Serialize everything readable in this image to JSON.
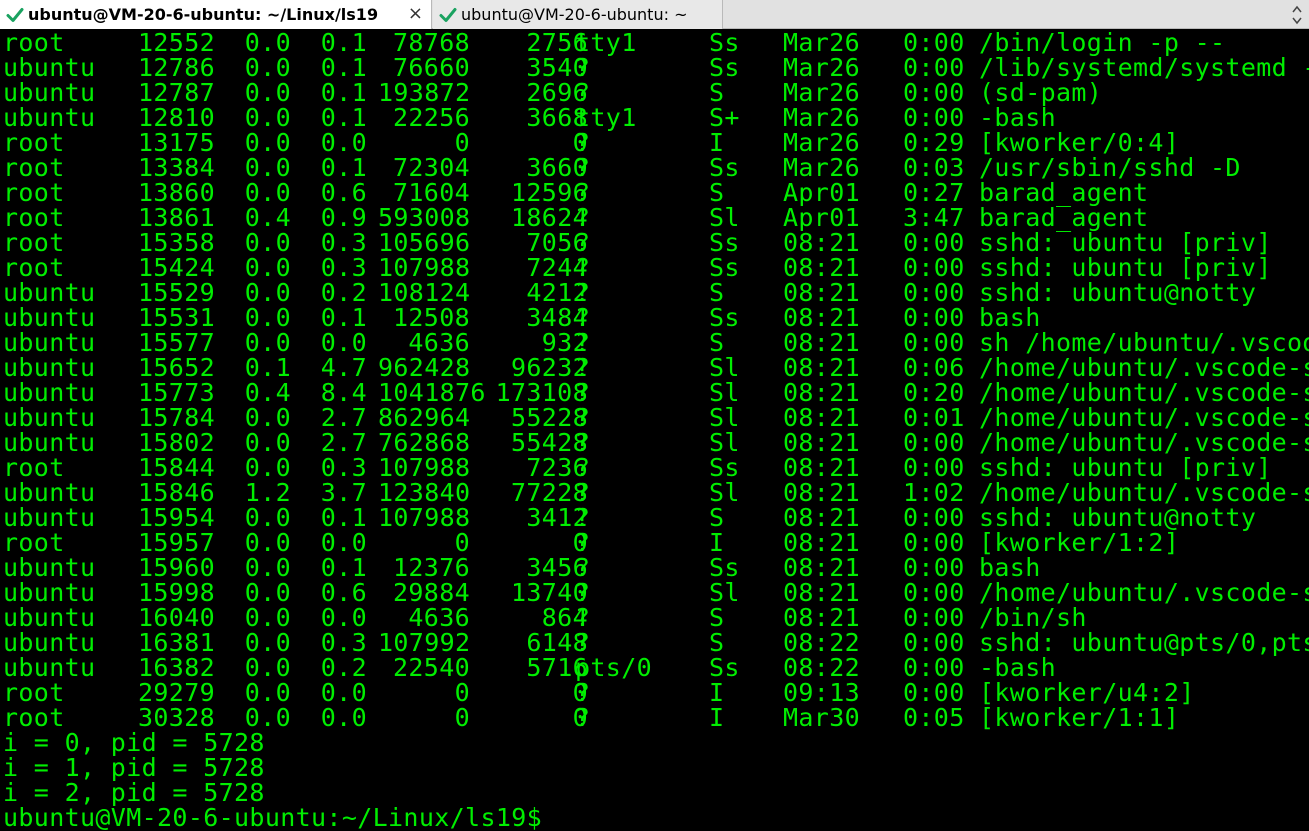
{
  "tabs": [
    {
      "label": "ubuntu@VM-20-6-ubuntu: ~/Linux/ls19",
      "active": true,
      "close": "×"
    },
    {
      "label": "ubuntu@VM-20-6-ubuntu: ~",
      "active": false
    }
  ],
  "colors": {
    "terminal_fg": "#00ee00",
    "terminal_bg": "#000000",
    "check": "#1aa260"
  },
  "processes": [
    {
      "user": "root",
      "pid": "12552",
      "cpu": "0.0",
      "mem": "0.1",
      "vsz": "78768",
      "rss": "2756",
      "tty": "tty1",
      "stat": "Ss",
      "start": "Mar26",
      "time": "0:00",
      "cmd": "/bin/login -p --"
    },
    {
      "user": "ubuntu",
      "pid": "12786",
      "cpu": "0.0",
      "mem": "0.1",
      "vsz": "76660",
      "rss": "3540",
      "tty": "?",
      "stat": "Ss",
      "start": "Mar26",
      "time": "0:00",
      "cmd": "/lib/systemd/systemd -"
    },
    {
      "user": "ubuntu",
      "pid": "12787",
      "cpu": "0.0",
      "mem": "0.1",
      "vsz": "193872",
      "rss": "2696",
      "tty": "?",
      "stat": "S",
      "start": "Mar26",
      "time": "0:00",
      "cmd": "(sd-pam)"
    },
    {
      "user": "ubuntu",
      "pid": "12810",
      "cpu": "0.0",
      "mem": "0.1",
      "vsz": "22256",
      "rss": "3668",
      "tty": "tty1",
      "stat": "S+",
      "start": "Mar26",
      "time": "0:00",
      "cmd": "-bash"
    },
    {
      "user": "root",
      "pid": "13175",
      "cpu": "0.0",
      "mem": "0.0",
      "vsz": "0",
      "rss": "0",
      "tty": "?",
      "stat": "I",
      "start": "Mar26",
      "time": "0:29",
      "cmd": "[kworker/0:4]"
    },
    {
      "user": "root",
      "pid": "13384",
      "cpu": "0.0",
      "mem": "0.1",
      "vsz": "72304",
      "rss": "3660",
      "tty": "?",
      "stat": "Ss",
      "start": "Mar26",
      "time": "0:03",
      "cmd": "/usr/sbin/sshd -D"
    },
    {
      "user": "root",
      "pid": "13860",
      "cpu": "0.0",
      "mem": "0.6",
      "vsz": "71604",
      "rss": "12596",
      "tty": "?",
      "stat": "S",
      "start": "Apr01",
      "time": "0:27",
      "cmd": "barad_agent"
    },
    {
      "user": "root",
      "pid": "13861",
      "cpu": "0.4",
      "mem": "0.9",
      "vsz": "593008",
      "rss": "18624",
      "tty": "?",
      "stat": "Sl",
      "start": "Apr01",
      "time": "3:47",
      "cmd": "barad_agent"
    },
    {
      "user": "root",
      "pid": "15358",
      "cpu": "0.0",
      "mem": "0.3",
      "vsz": "105696",
      "rss": "7056",
      "tty": "?",
      "stat": "Ss",
      "start": "08:21",
      "time": "0:00",
      "cmd": "sshd: ubuntu [priv]"
    },
    {
      "user": "root",
      "pid": "15424",
      "cpu": "0.0",
      "mem": "0.3",
      "vsz": "107988",
      "rss": "7244",
      "tty": "?",
      "stat": "Ss",
      "start": "08:21",
      "time": "0:00",
      "cmd": "sshd: ubuntu [priv]"
    },
    {
      "user": "ubuntu",
      "pid": "15529",
      "cpu": "0.0",
      "mem": "0.2",
      "vsz": "108124",
      "rss": "4212",
      "tty": "?",
      "stat": "S",
      "start": "08:21",
      "time": "0:00",
      "cmd": "sshd: ubuntu@notty"
    },
    {
      "user": "ubuntu",
      "pid": "15531",
      "cpu": "0.0",
      "mem": "0.1",
      "vsz": "12508",
      "rss": "3484",
      "tty": "?",
      "stat": "Ss",
      "start": "08:21",
      "time": "0:00",
      "cmd": "bash"
    },
    {
      "user": "ubuntu",
      "pid": "15577",
      "cpu": "0.0",
      "mem": "0.0",
      "vsz": "4636",
      "rss": "932",
      "tty": "?",
      "stat": "S",
      "start": "08:21",
      "time": "0:00",
      "cmd": "sh /home/ubuntu/.vscod"
    },
    {
      "user": "ubuntu",
      "pid": "15652",
      "cpu": "0.1",
      "mem": "4.7",
      "vsz": "962428",
      "rss": "96232",
      "tty": "?",
      "stat": "Sl",
      "start": "08:21",
      "time": "0:06",
      "cmd": "/home/ubuntu/.vscode-s"
    },
    {
      "user": "ubuntu",
      "pid": "15773",
      "cpu": "0.4",
      "mem": "8.4",
      "vsz": "1041876",
      "rss": "173108",
      "tty": "?",
      "stat": "Sl",
      "start": "08:21",
      "time": "0:20",
      "cmd": "/home/ubuntu/.vscode-s"
    },
    {
      "user": "ubuntu",
      "pid": "15784",
      "cpu": "0.0",
      "mem": "2.7",
      "vsz": "862964",
      "rss": "55228",
      "tty": "?",
      "stat": "Sl",
      "start": "08:21",
      "time": "0:01",
      "cmd": "/home/ubuntu/.vscode-s"
    },
    {
      "user": "ubuntu",
      "pid": "15802",
      "cpu": "0.0",
      "mem": "2.7",
      "vsz": "762868",
      "rss": "55428",
      "tty": "?",
      "stat": "Sl",
      "start": "08:21",
      "time": "0:00",
      "cmd": "/home/ubuntu/.vscode-s"
    },
    {
      "user": "root",
      "pid": "15844",
      "cpu": "0.0",
      "mem": "0.3",
      "vsz": "107988",
      "rss": "7236",
      "tty": "?",
      "stat": "Ss",
      "start": "08:21",
      "time": "0:00",
      "cmd": "sshd: ubuntu [priv]"
    },
    {
      "user": "ubuntu",
      "pid": "15846",
      "cpu": "1.2",
      "mem": "3.7",
      "vsz": "123840",
      "rss": "77228",
      "tty": "?",
      "stat": "Sl",
      "start": "08:21",
      "time": "1:02",
      "cmd": "/home/ubuntu/.vscode-s"
    },
    {
      "user": "ubuntu",
      "pid": "15954",
      "cpu": "0.0",
      "mem": "0.1",
      "vsz": "107988",
      "rss": "3412",
      "tty": "?",
      "stat": "S",
      "start": "08:21",
      "time": "0:00",
      "cmd": "sshd: ubuntu@notty"
    },
    {
      "user": "root",
      "pid": "15957",
      "cpu": "0.0",
      "mem": "0.0",
      "vsz": "0",
      "rss": "0",
      "tty": "?",
      "stat": "I",
      "start": "08:21",
      "time": "0:00",
      "cmd": "[kworker/1:2]"
    },
    {
      "user": "ubuntu",
      "pid": "15960",
      "cpu": "0.0",
      "mem": "0.1",
      "vsz": "12376",
      "rss": "3456",
      "tty": "?",
      "stat": "Ss",
      "start": "08:21",
      "time": "0:00",
      "cmd": "bash"
    },
    {
      "user": "ubuntu",
      "pid": "15998",
      "cpu": "0.0",
      "mem": "0.6",
      "vsz": "29884",
      "rss": "13740",
      "tty": "?",
      "stat": "Sl",
      "start": "08:21",
      "time": "0:00",
      "cmd": "/home/ubuntu/.vscode-s"
    },
    {
      "user": "ubuntu",
      "pid": "16040",
      "cpu": "0.0",
      "mem": "0.0",
      "vsz": "4636",
      "rss": "864",
      "tty": "?",
      "stat": "S",
      "start": "08:21",
      "time": "0:00",
      "cmd": "/bin/sh"
    },
    {
      "user": "ubuntu",
      "pid": "16381",
      "cpu": "0.0",
      "mem": "0.3",
      "vsz": "107992",
      "rss": "6148",
      "tty": "?",
      "stat": "S",
      "start": "08:22",
      "time": "0:00",
      "cmd": "sshd: ubuntu@pts/0,pts"
    },
    {
      "user": "ubuntu",
      "pid": "16382",
      "cpu": "0.0",
      "mem": "0.2",
      "vsz": "22540",
      "rss": "5716",
      "tty": "pts/0",
      "stat": "Ss",
      "start": "08:22",
      "time": "0:00",
      "cmd": "-bash"
    },
    {
      "user": "root",
      "pid": "29279",
      "cpu": "0.0",
      "mem": "0.0",
      "vsz": "0",
      "rss": "0",
      "tty": "?",
      "stat": "I",
      "start": "09:13",
      "time": "0:00",
      "cmd": "[kworker/u4:2]"
    },
    {
      "user": "root",
      "pid": "30328",
      "cpu": "0.0",
      "mem": "0.0",
      "vsz": "0",
      "rss": "0",
      "tty": "?",
      "stat": "I",
      "start": "Mar30",
      "time": "0:05",
      "cmd": "[kworker/1:1]"
    }
  ],
  "output_lines": [
    "i = 0, pid = 5728",
    "i = 1, pid = 5728",
    "i = 2, pid = 5728"
  ],
  "prompt": "ubuntu@VM-20-6-ubuntu:~/Linux/ls19$"
}
